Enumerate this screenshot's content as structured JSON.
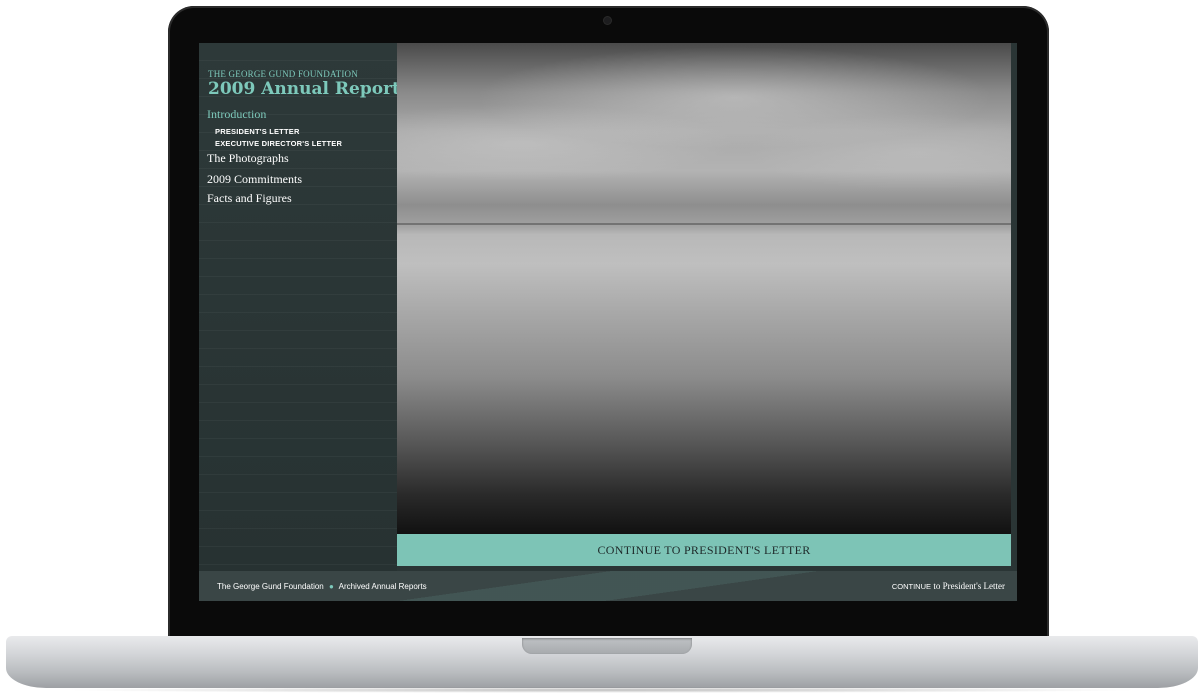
{
  "sidebar": {
    "org_name": "THE GEORGE GUND FOUNDATION",
    "report_title": "2009 Annual Report",
    "nav": {
      "introduction": "Introduction",
      "sub_items": [
        "PRESIDENT'S LETTER",
        "EXECUTIVE DIRECTOR'S LETTER"
      ],
      "main_items": [
        "The Photographs",
        "2009 Commitments",
        "Facts and Figures"
      ]
    }
  },
  "main": {
    "continue_button": "CONTINUE TO PRESIDENT'S LETTER"
  },
  "footer": {
    "link_foundation": "The George Gund Foundation",
    "separator": "●",
    "link_archives": "Archived Annual Reports",
    "continue_prefix": "CONTINUE",
    "continue_rest": "to President's Letter"
  },
  "colors": {
    "accent": "#7dc9bb",
    "sidebar_bg": "#2d3939",
    "continue_bar": "#7dc4b6",
    "footer_bg": "#3a4646"
  }
}
